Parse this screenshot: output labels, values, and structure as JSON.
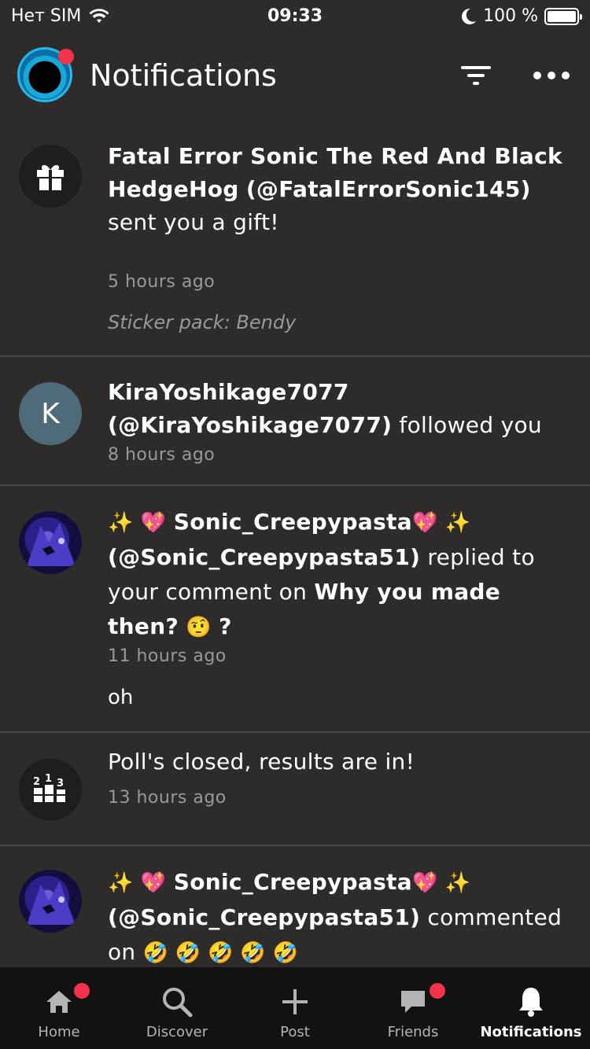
{
  "status_bar": {
    "carrier": "Нет SIM",
    "time": "09:33",
    "battery": "100 %"
  },
  "header": {
    "title": "Notifications"
  },
  "notifications": [
    {
      "type": "gift",
      "name": "Fatal Error Sonic The Red And Black HedgeHog",
      "handle": "(@FatalErrorSonic145)",
      "action": "sent you a gift!",
      "time": "5 hours ago",
      "extra": "Sticker pack: Bendy"
    },
    {
      "type": "follow",
      "avatar_letter": "K",
      "name": "KiraYoshikage7077",
      "handle": "(@KiraYoshikage7077)",
      "action": "followed you",
      "time": "8 hours ago"
    },
    {
      "type": "reply",
      "sparkle": "✨",
      "heart": "💖",
      "name": "Sonic_Creepypasta",
      "handle": "(@Sonic_Creepypasta51)",
      "action": "replied to your comment on",
      "target": "Why you made then?",
      "target_emoji": "🤨",
      "target_suffix": "?",
      "time": "11 hours ago",
      "extra": "oh"
    },
    {
      "type": "poll",
      "text": "Poll's closed, results are in!",
      "time": "13 hours ago"
    },
    {
      "type": "comment",
      "sparkle": "✨",
      "heart": "💖",
      "name": "Sonic_Creepypasta",
      "handle": "(@Sonic_Creepypasta51)",
      "action": "commented on",
      "emojis": "🤣 🤣 🤣 🤣 🤣"
    }
  ],
  "tabs": [
    {
      "label": "Home",
      "icon": "home-icon",
      "badge": true
    },
    {
      "label": "Discover",
      "icon": "search-icon",
      "badge": false
    },
    {
      "label": "Post",
      "icon": "plus-icon",
      "badge": false
    },
    {
      "label": "Friends",
      "icon": "chat-icon",
      "badge": true
    },
    {
      "label": "Notifications",
      "icon": "bell-icon",
      "badge": false,
      "active": true
    }
  ],
  "colors": {
    "background": "#2d2c2a",
    "badge": "#f2334b",
    "tabbar": "#121212",
    "secondary_text": "#9a9997"
  }
}
